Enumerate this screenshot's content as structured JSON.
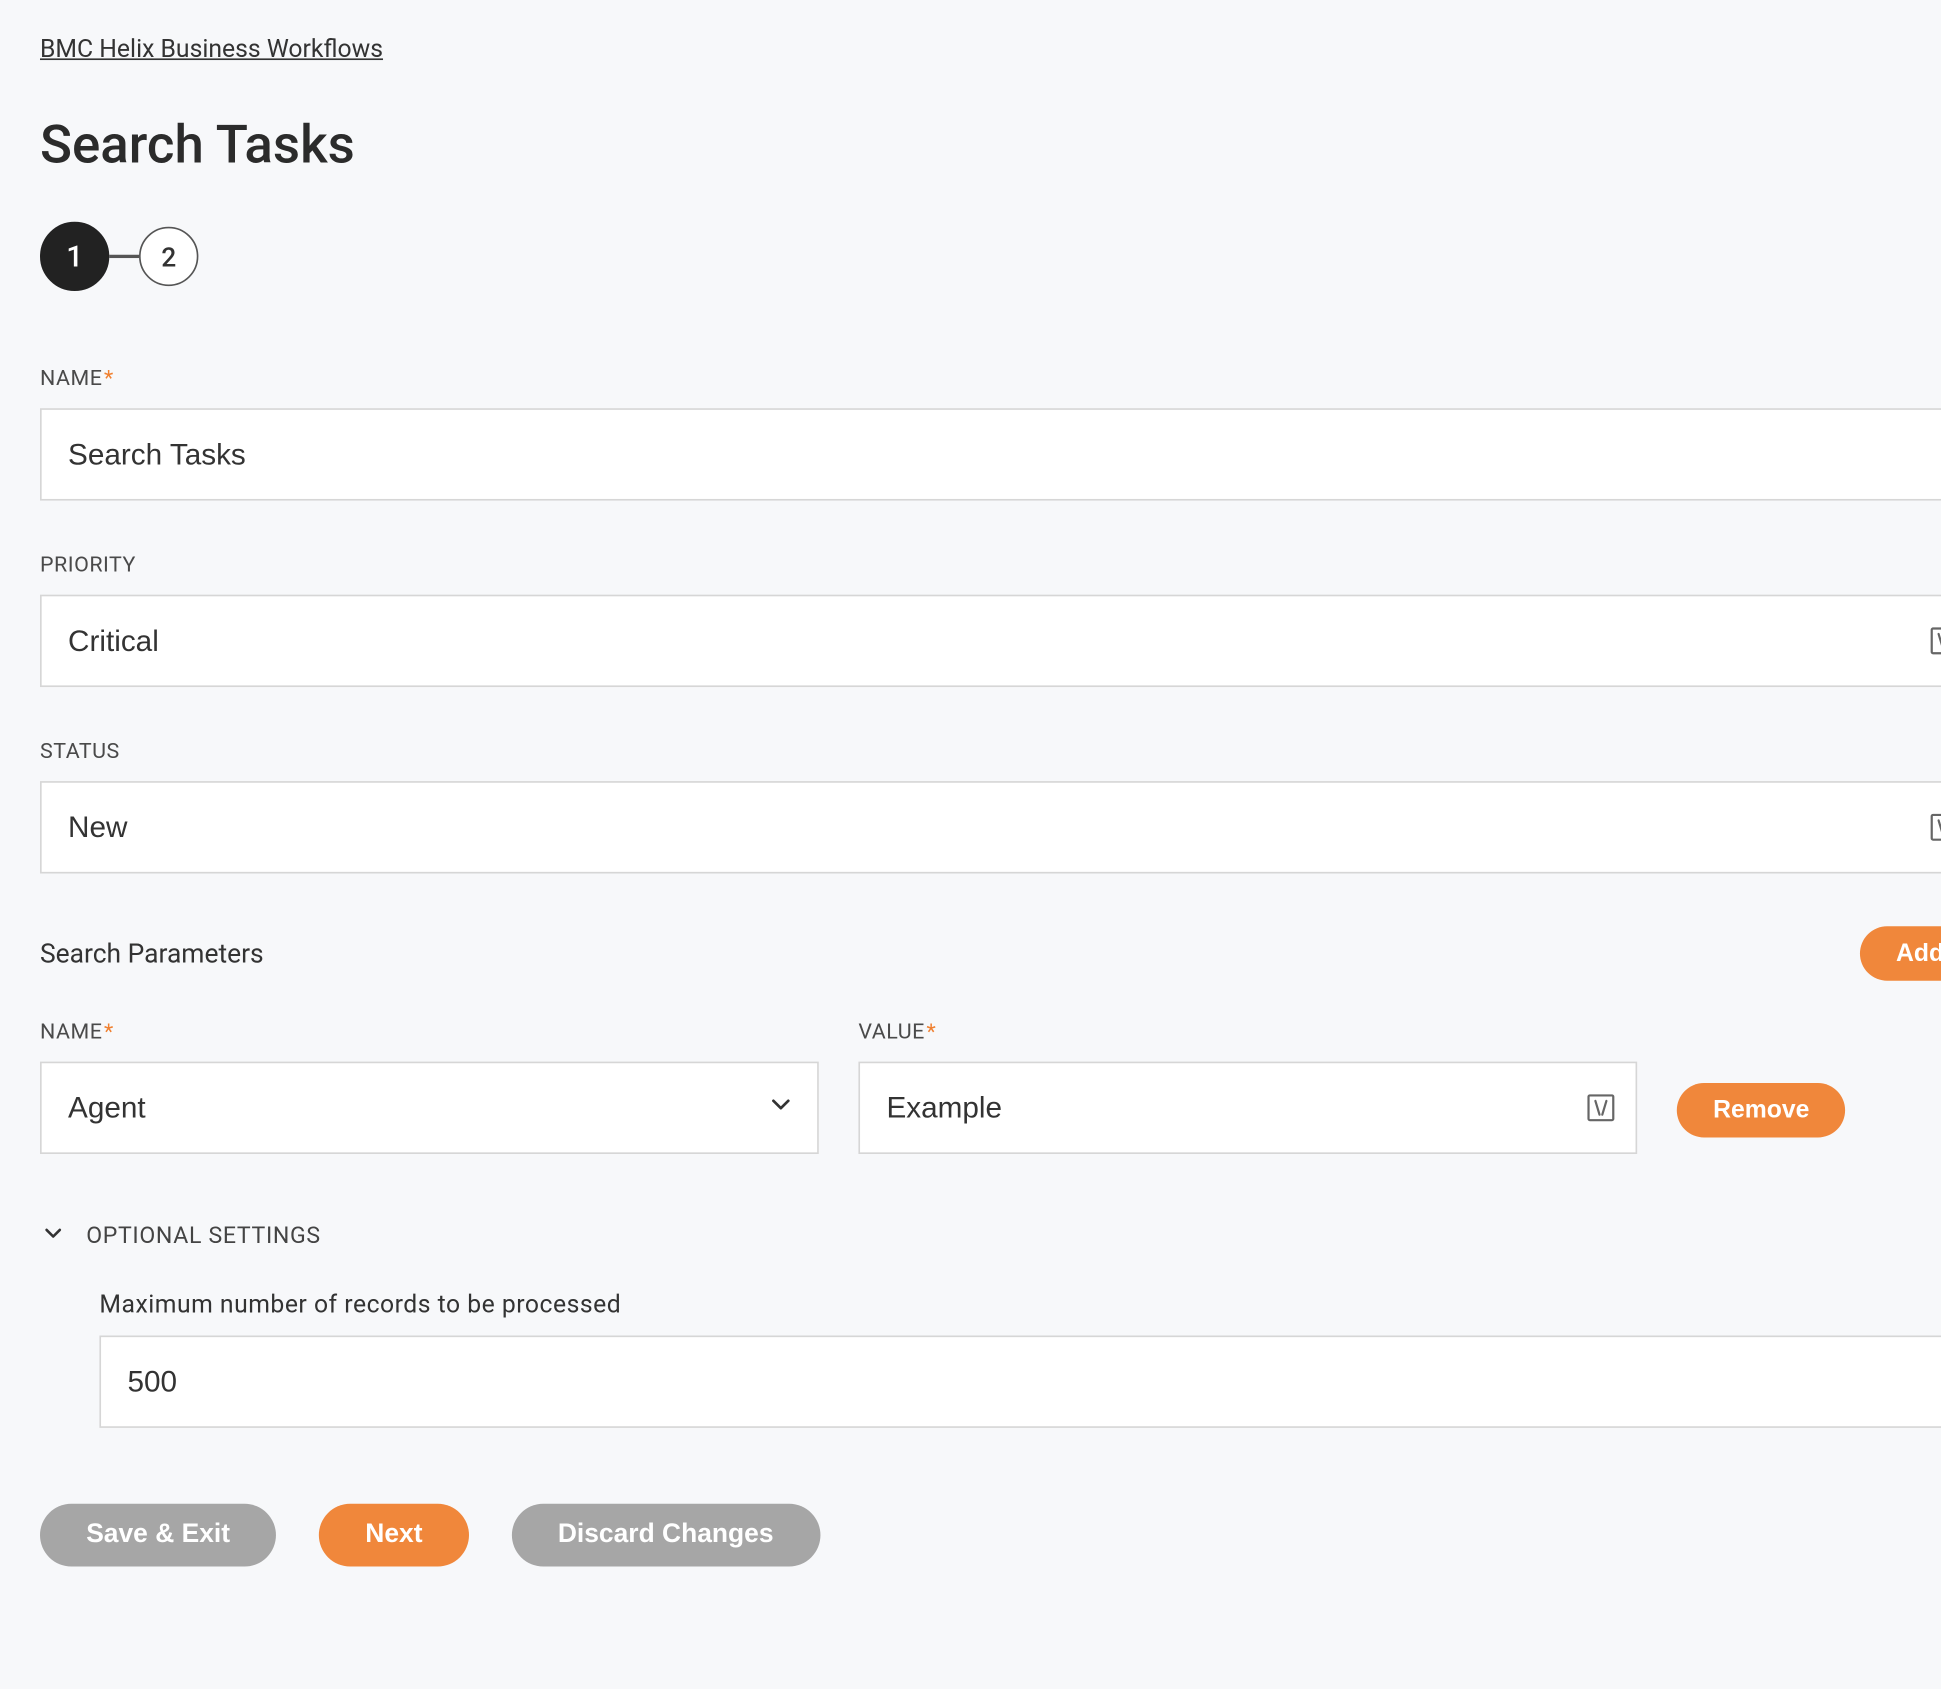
{
  "breadcrumb": "BMC Helix Business Workflows",
  "page_title": "Search Tasks",
  "stepper": {
    "step1": "1",
    "step2": "2"
  },
  "fields": {
    "name_label": "NAME",
    "name_value": "Search Tasks",
    "priority_label": "PRIORITY",
    "priority_value": "Critical",
    "status_label": "STATUS",
    "status_value": "New"
  },
  "params_section": {
    "title": "Search Parameters",
    "add_label": "Add",
    "row": {
      "name_label": "NAME",
      "name_value": "Agent",
      "value_label": "VALUE",
      "value_value": "Example",
      "remove_label": "Remove"
    }
  },
  "optional": {
    "header": "OPTIONAL SETTINGS",
    "max_records_label": "Maximum number of records to be processed",
    "max_records_value": "500"
  },
  "footer": {
    "save_exit": "Save & Exit",
    "next": "Next",
    "discard": "Discard Changes"
  }
}
